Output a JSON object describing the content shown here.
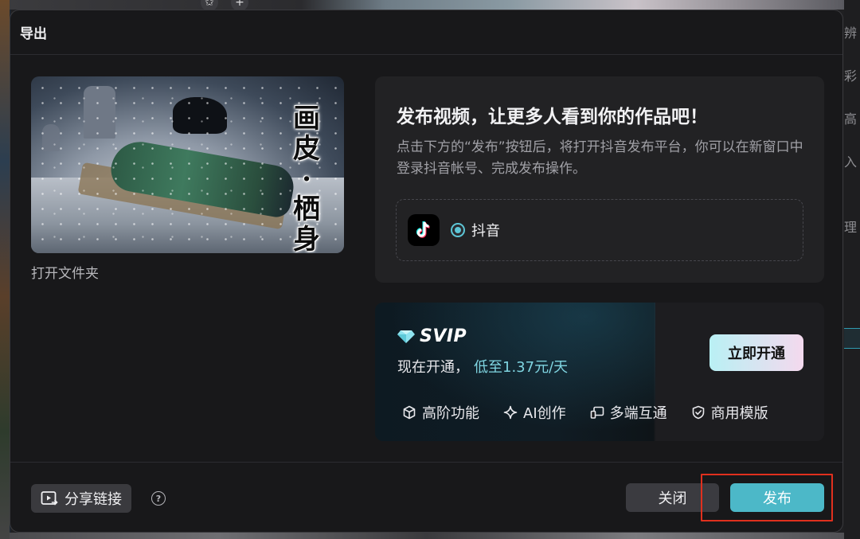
{
  "dialog": {
    "title": "导出"
  },
  "cover": {
    "calligraphy": [
      "画",
      "皮",
      "·",
      "栖",
      "身"
    ],
    "open_folder_label": "打开文件夹"
  },
  "publish": {
    "title": "发布视频，让更多人看到你的作品吧！",
    "description": "点击下方的“发布”按钮后，将打开抖音发布平台，你可以在新窗口中登录抖音帐号、完成发布操作。",
    "platform": {
      "icon": "tiktok-icon",
      "label": "抖音",
      "selected": true
    }
  },
  "svip": {
    "badge": "SVIP",
    "subtitle_prefix": "现在开通，",
    "subtitle_price": "低至1.37元/天",
    "cta_label": "立即开通",
    "features": [
      {
        "icon": "cube-icon",
        "label": "高阶功能"
      },
      {
        "icon": "sparkle-icon",
        "label": "AI创作"
      },
      {
        "icon": "multi-device-icon",
        "label": "多端互通"
      },
      {
        "icon": "shield-icon",
        "label": "商用模版"
      }
    ],
    "accent_color": "#7fd4e0"
  },
  "footer": {
    "share_label": "分享链接",
    "help_icon": "help-icon",
    "close_label": "关闭",
    "publish_label": "发布",
    "publish_color": "#4cb8c8",
    "highlight_color": "#e0301e"
  },
  "background": {
    "right_panel_texts": [
      "辨",
      "彩",
      "高",
      "入",
      "理"
    ]
  }
}
